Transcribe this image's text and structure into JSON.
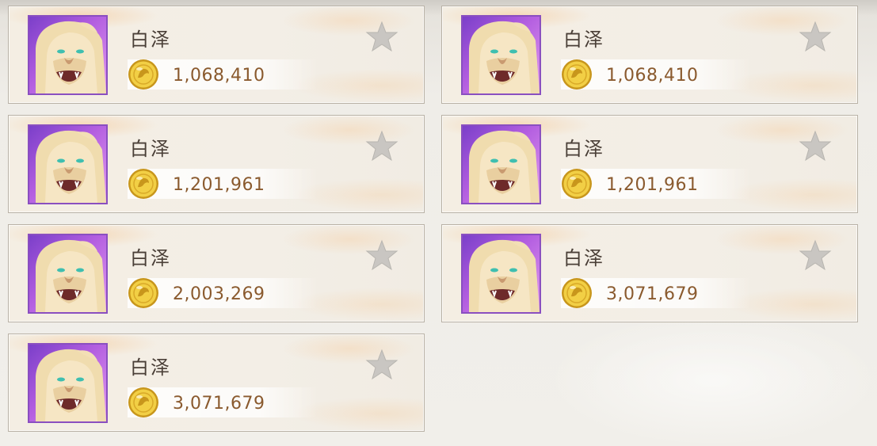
{
  "items": [
    {
      "name": "白泽",
      "price": "1,068,410",
      "favorited": false
    },
    {
      "name": "白泽",
      "price": "1,068,410",
      "favorited": false
    },
    {
      "name": "白泽",
      "price": "1,201,961",
      "favorited": false
    },
    {
      "name": "白泽",
      "price": "1,201,961",
      "favorited": false
    },
    {
      "name": "白泽",
      "price": "2,003,269",
      "favorited": false
    },
    {
      "name": "白泽",
      "price": "3,071,679",
      "favorited": false
    },
    {
      "name": "白泽",
      "price": "3,071,679",
      "favorited": false
    }
  ],
  "icons": {
    "currency": "gold-coin-icon",
    "favorite": "star-icon",
    "portrait": "white-lion-portrait"
  },
  "colors": {
    "portrait_bg": "#9b4fd6",
    "price_text": "#8a5a2e",
    "name_text": "#4a3f37",
    "star_inactive": "#c9c6c2",
    "coin": "#e0b52a"
  }
}
